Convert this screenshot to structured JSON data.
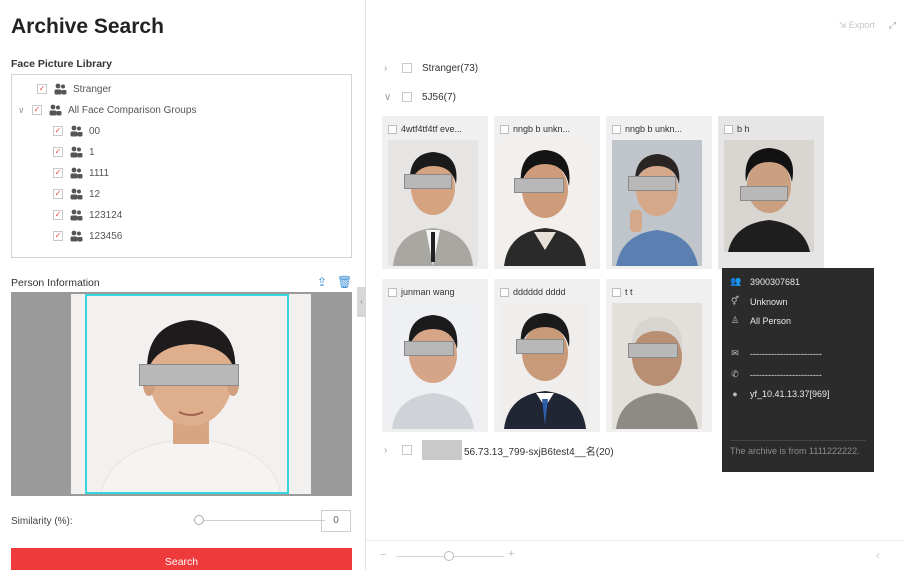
{
  "page": {
    "title": "Archive Search"
  },
  "left": {
    "library_label": "Face Picture Library",
    "tree": [
      {
        "label": "Stranger",
        "checked": true
      },
      {
        "label": "All Face Comparison Groups",
        "checked": true
      },
      {
        "label": "00",
        "checked": true
      },
      {
        "label": "1",
        "checked": true
      },
      {
        "label": "1111",
        "checked": true
      },
      {
        "label": "12",
        "checked": true
      },
      {
        "label": "123124",
        "checked": true
      },
      {
        "label": "123456",
        "checked": true
      }
    ],
    "person_info_label": "Person Information",
    "similarity_label": "Similarity (%):",
    "similarity_value": "0",
    "search_label": "Search"
  },
  "right": {
    "toolbar": {
      "export_label": "Export"
    },
    "groups": [
      {
        "label": "Stranger(73)",
        "expanded": false
      },
      {
        "label": "5J56(7)",
        "expanded": true
      },
      {
        "label": "56.73.13_799-sxjB6test4__名(20)",
        "expanded": false
      }
    ],
    "cards": [
      {
        "name": "4wtf4tf4tf eve..."
      },
      {
        "name": "nngb b unkn..."
      },
      {
        "name": "nngb b unkn..."
      },
      {
        "name": "b h"
      },
      {
        "name": "junman  wang"
      },
      {
        "name": "dddddd dddd"
      },
      {
        "name": "t t"
      }
    ],
    "tooltip": {
      "id": "3900307681",
      "gender": "Unknown",
      "group": "All Person",
      "phone": "------------------------",
      "email": "------------------------",
      "location": "yf_10.41.13.37[969]",
      "footer": "The archive is from 1111222222."
    }
  },
  "colors": {
    "accent": "#ee3a3a",
    "selection": "#35d6dc",
    "tooltip_bg": "#2b2b2b",
    "link": "#3a8fd8"
  }
}
